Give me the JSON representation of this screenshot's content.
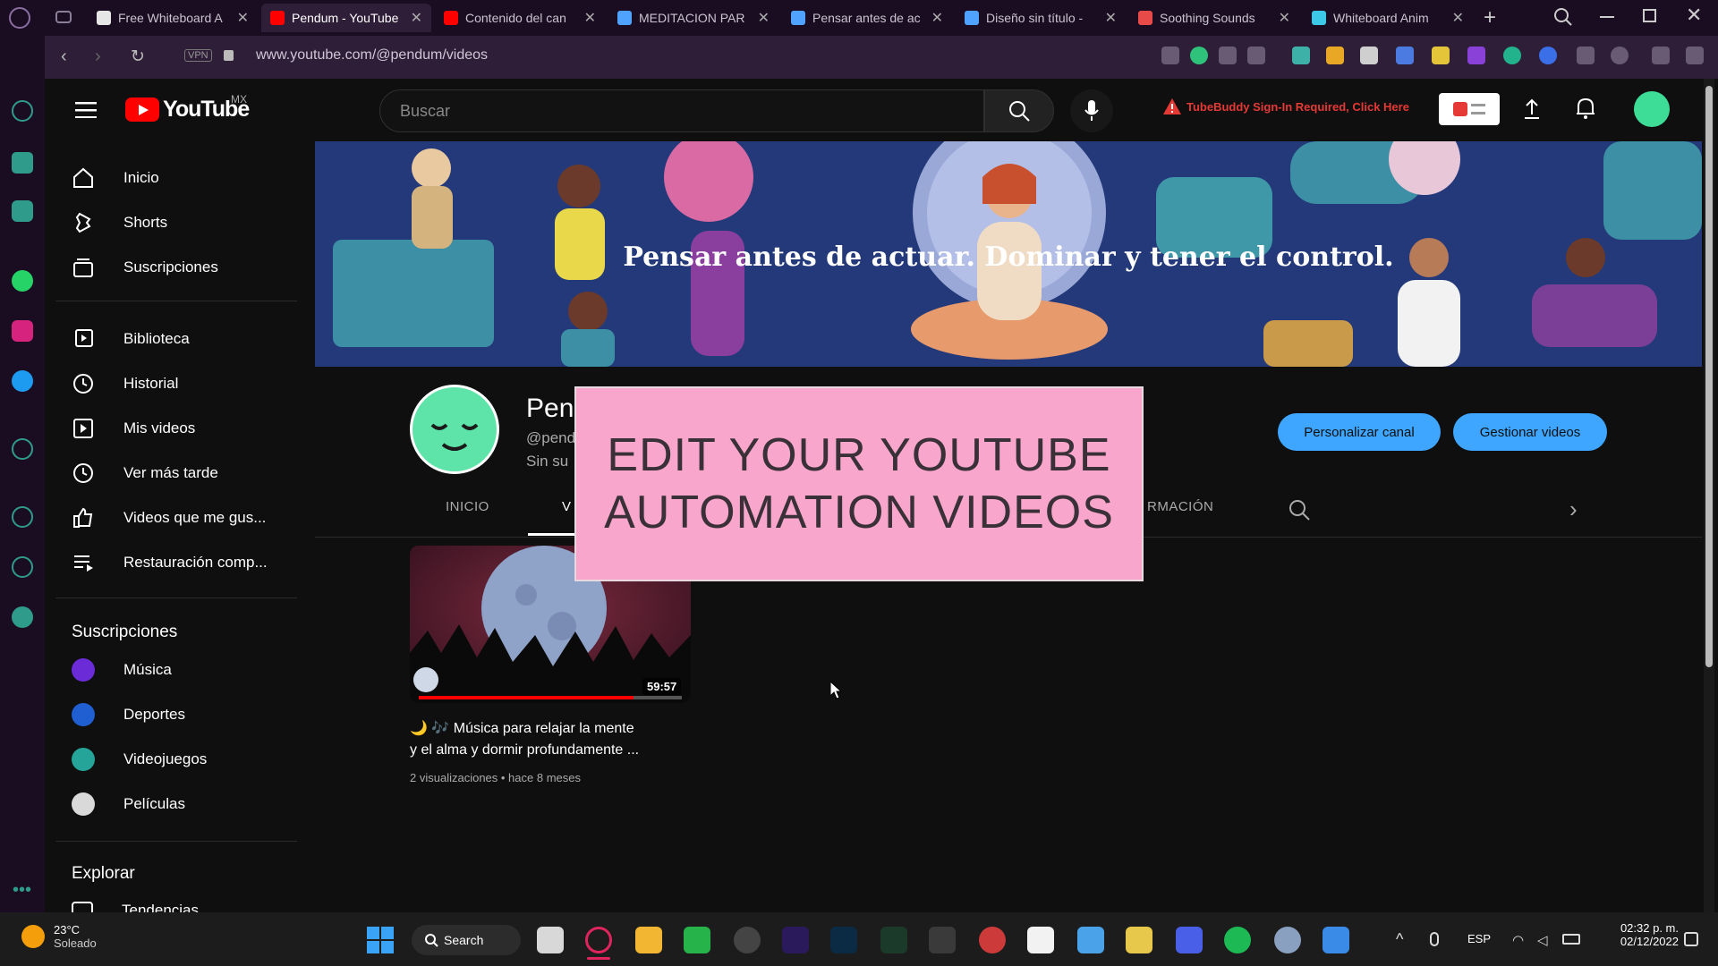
{
  "browser": {
    "tabs": [
      {
        "title": "Free Whiteboard A",
        "color": "#e6e6e6"
      },
      {
        "title": "Pendum - YouTube",
        "color": "#ff0000",
        "active": true
      },
      {
        "title": "Contenido del can",
        "color": "#ff0000"
      },
      {
        "title": "MEDITACION PAR",
        "color": "#4fa3ff"
      },
      {
        "title": "Pensar antes de ac",
        "color": "#4fa3ff"
      },
      {
        "title": "Diseño sin título -",
        "color": "#4fa3ff"
      },
      {
        "title": "Soothing Sounds",
        "color": "#e84a4a"
      },
      {
        "title": "Whiteboard Anim",
        "color": "#3cc9e8"
      }
    ],
    "url": "www.youtube.com/@pendum/videos",
    "vpn_label": "VPN"
  },
  "youtube": {
    "logo_text": "YouTube",
    "region": "MX",
    "search_placeholder": "Buscar",
    "tubebuddy_text": "TubeBuddy Sign-In Required, Click Here",
    "nav_main": [
      {
        "label": "Inicio",
        "icon": "home-icon"
      },
      {
        "label": "Shorts",
        "icon": "shorts-icon"
      },
      {
        "label": "Suscripciones",
        "icon": "subscriptions-icon"
      }
    ],
    "nav_library": [
      {
        "label": "Biblioteca",
        "icon": "library-icon"
      },
      {
        "label": "Historial",
        "icon": "history-icon"
      },
      {
        "label": "Mis videos",
        "icon": "play-icon"
      },
      {
        "label": "Ver más tarde",
        "icon": "clock-icon"
      },
      {
        "label": "Videos que me gus...",
        "icon": "thumbs-up-icon"
      },
      {
        "label": "Restauración comp...",
        "icon": "playlist-icon"
      }
    ],
    "subs_heading": "Suscripciones",
    "subscriptions": [
      {
        "label": "Música",
        "color": "#6b2bd6"
      },
      {
        "label": "Deportes",
        "color": "#1f5fd1"
      },
      {
        "label": "Videojuegos",
        "color": "#25a59a"
      },
      {
        "label": "Películas",
        "color": "#d9d9d9"
      }
    ],
    "explore_heading": "Explorar",
    "explore_first": "Tendencias",
    "banner_text": "Pensar antes de actuar. Dominar y tener el control.",
    "channel_name": "Pen",
    "channel_handle": "@pend",
    "channel_subs": "Sin su",
    "customize_button": "Personalizar canal",
    "manage_button": "Gestionar videos",
    "tabs": [
      "INICIO",
      "V",
      "RMACIÓN"
    ],
    "video": {
      "duration": "59:57",
      "title_line1": "🌙 🎶 Música para relajar la mente",
      "title_line2": "y el alma y dormir profundamente ...",
      "meta": "2 visualizaciones • hace 8 meses"
    }
  },
  "overlay": {
    "line1": "EDIT YOUR YOUTUBE",
    "line2": "AUTOMATION VIDEOS"
  },
  "taskbar": {
    "temp": "23°C",
    "weather": "Soleado",
    "search_label": "Search",
    "lang": "ESP",
    "time": "02:32 p. m.",
    "date": "02/12/2022"
  }
}
